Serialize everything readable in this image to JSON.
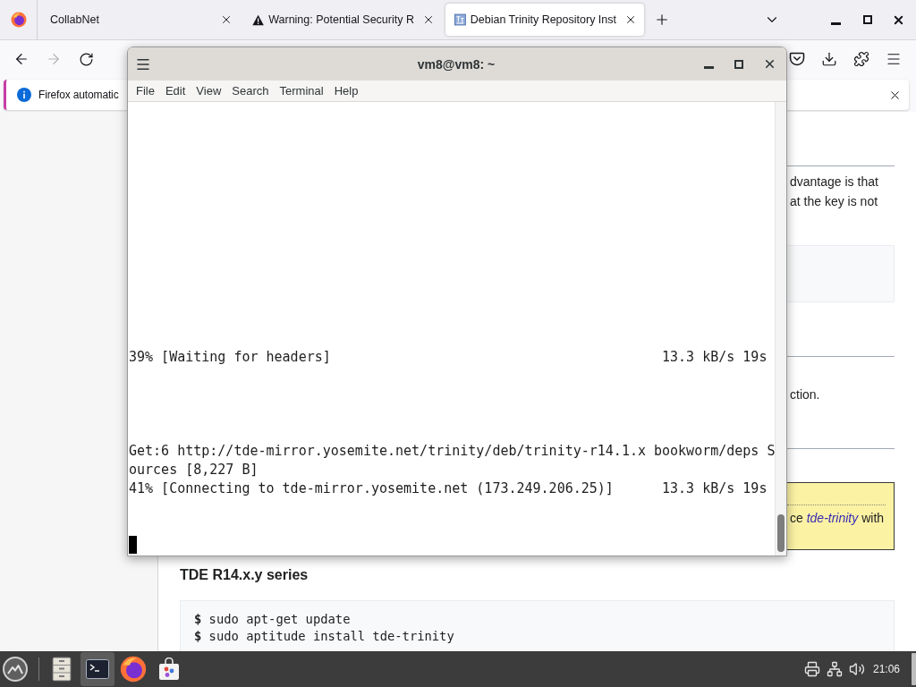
{
  "browser": {
    "tabs": [
      {
        "kind": "plain",
        "label": "CollabNet",
        "selected": false
      },
      {
        "kind": "warning",
        "label": "Warning: Potential Security R",
        "selected": false
      },
      {
        "kind": "site",
        "label": "Debian Trinity Repository Inst",
        "selected": true
      }
    ],
    "navigation": {
      "back_disabled": false,
      "forward_disabled": true
    },
    "notification": {
      "text": "Firefox automatic"
    },
    "page": {
      "paragraph_lines": [
        "dvantage is that",
        "at the key is not"
      ],
      "sentence_end": "ction.",
      "note": {
        "before": "ce",
        "link": "tde-trinity",
        "after": "with"
      },
      "heading": "TDE R14.x.y series",
      "code_lines": [
        "**$** sudo apt-get update",
        "**$** sudo aptitude install tde-trinity"
      ]
    }
  },
  "terminal": {
    "title": "vm8@vm8: ~",
    "menu": [
      "File",
      "Edit",
      "View",
      "Search",
      "Terminal",
      "Help"
    ],
    "lines": [
      {
        "text": "39% [Waiting for headers]",
        "rate": "13.3 kB/s 19s"
      },
      {
        "text": "Get:6 http://tde-mirror.yosemite.net/trinity/deb/trinity-r14.1.x bookworm/deps S"
      },
      {
        "text": "ources [8,227 B]"
      },
      {
        "text": "41% [Connecting to tde-mirror.yosemite.net (173.249.206.25)]",
        "rate": "13.3 kB/s 19s"
      }
    ]
  },
  "taskbar": {
    "apps": [
      {
        "kind": "files",
        "active": false
      },
      {
        "kind": "terminal",
        "active": true
      },
      {
        "kind": "browser",
        "active": false
      },
      {
        "kind": "store",
        "active": false
      }
    ],
    "clock": "21:06"
  }
}
